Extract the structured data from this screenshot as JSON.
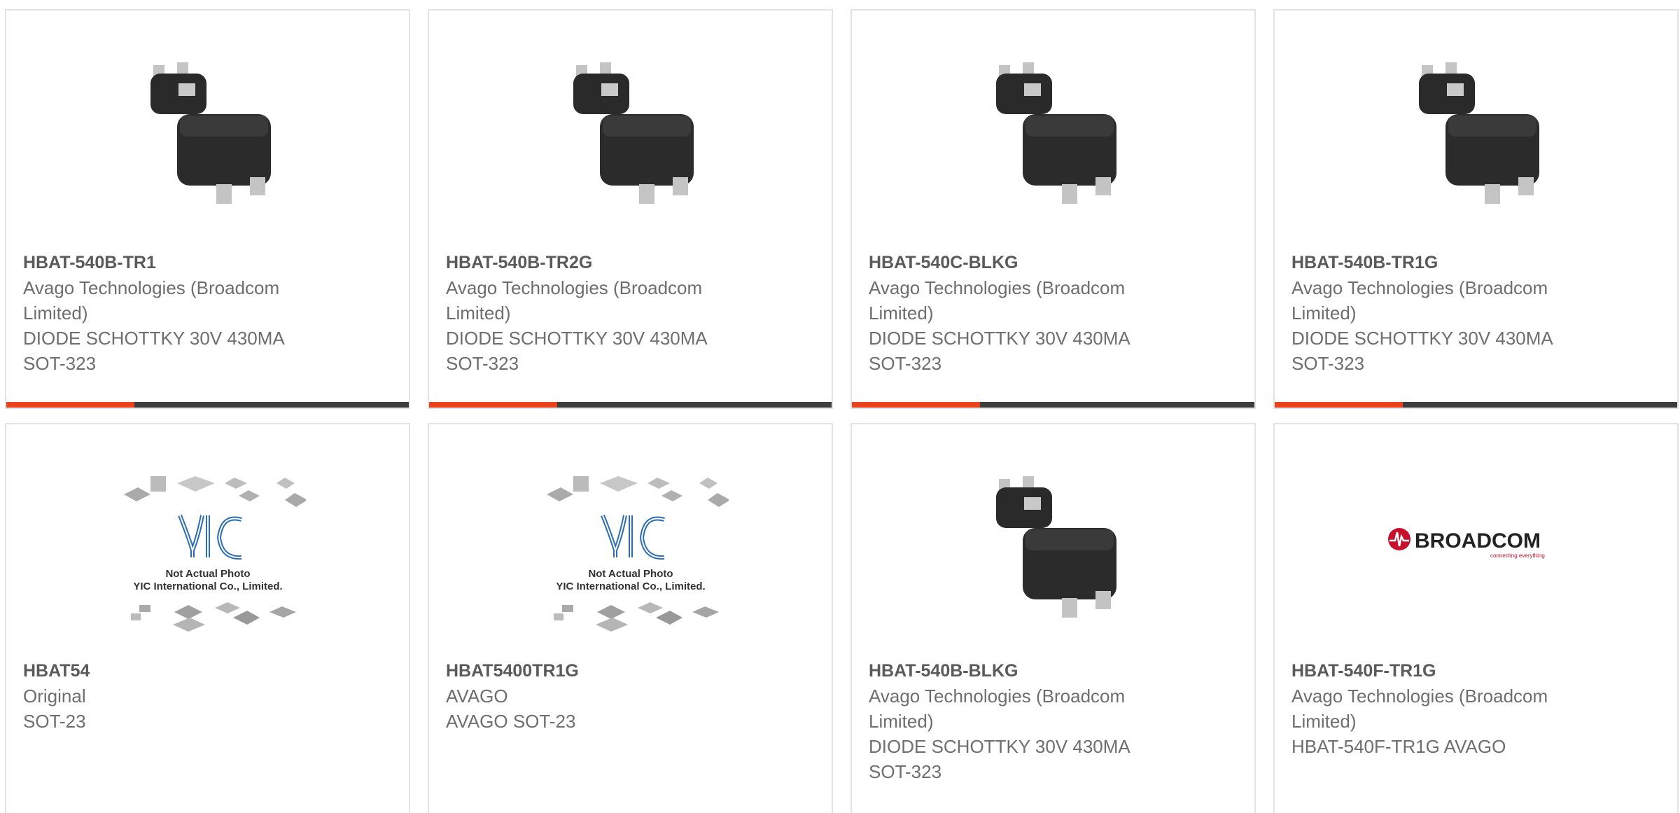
{
  "products": [
    {
      "part": "HBAT-540B-TR1",
      "lines": [
        "Avago Technologies (Broadcom",
        "Limited)",
        "DIODE SCHOTTKY 30V 430MA",
        "SOT-323"
      ],
      "image": "sot-323-package"
    },
    {
      "part": "HBAT-540B-TR2G",
      "lines": [
        "Avago Technologies (Broadcom",
        "Limited)",
        "DIODE SCHOTTKY 30V 430MA",
        "SOT-323"
      ],
      "image": "sot-323-package"
    },
    {
      "part": "HBAT-540C-BLKG",
      "lines": [
        "Avago Technologies (Broadcom",
        "Limited)",
        "DIODE SCHOTTKY 30V 430MA",
        "SOT-323"
      ],
      "image": "sot-323-package"
    },
    {
      "part": "HBAT-540B-TR1G",
      "lines": [
        "Avago Technologies (Broadcom",
        "Limited)",
        "DIODE SCHOTTKY 30V 430MA",
        "SOT-323"
      ],
      "image": "sot-323-package"
    },
    {
      "part": "HBAT54",
      "lines": [
        "Original",
        "SOT-23"
      ],
      "image": "yic-placeholder",
      "image_caption": [
        "Not Actual Photo",
        "YIC International Co., Limited."
      ]
    },
    {
      "part": "HBAT5400TR1G",
      "lines": [
        "AVAGO",
        "AVAGO SOT-23"
      ],
      "image": "yic-placeholder",
      "image_caption": [
        "Not Actual Photo",
        "YIC International Co., Limited."
      ]
    },
    {
      "part": "HBAT-540B-BLKG",
      "lines": [
        "Avago Technologies (Broadcom",
        "Limited)",
        "DIODE SCHOTTKY 30V 430MA",
        "SOT-323"
      ],
      "image": "sot-323-package"
    },
    {
      "part": "HBAT-540F-TR1G",
      "lines": [
        "Avago Technologies (Broadcom",
        "Limited)",
        "HBAT-540F-TR1G AVAGO"
      ],
      "image": "broadcom-logo",
      "logo_text": "BROADCOM",
      "logo_tagline": "connecting everything"
    }
  ],
  "colors": {
    "accent": "#e8431d",
    "bar": "#3d3d3d",
    "border": "#e3e3e3"
  }
}
